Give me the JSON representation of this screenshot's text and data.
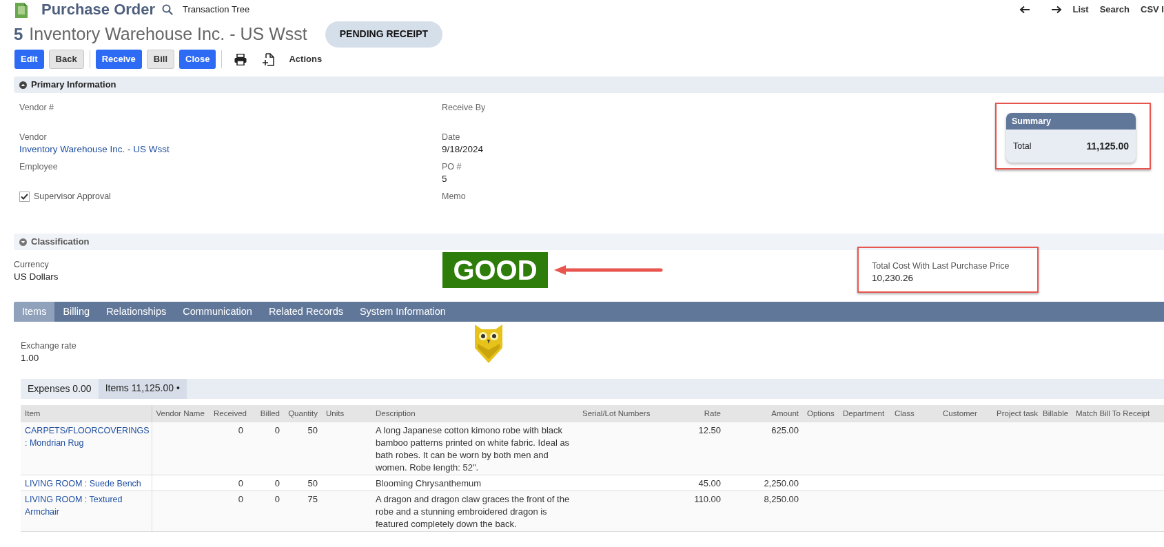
{
  "header": {
    "title": "Purchase Order",
    "link": "Transaction Tree",
    "nav": [
      "List",
      "Search",
      "CSV I"
    ]
  },
  "record": {
    "number": "5",
    "name": "Inventory Warehouse Inc. - US Wsst",
    "status": "PENDING RECEIPT"
  },
  "toolbar": {
    "buttons": [
      {
        "kind": "primary",
        "label": "Edit"
      },
      {
        "kind": "secondary",
        "label": "Back"
      },
      {
        "kind": "separator"
      },
      {
        "kind": "primary",
        "label": "Receive"
      },
      {
        "kind": "secondary",
        "label": "Bill"
      },
      {
        "kind": "primary",
        "label": "Close"
      },
      {
        "kind": "separator"
      },
      {
        "kind": "print"
      },
      {
        "kind": "new-document"
      },
      {
        "kind": "text",
        "label": "Actions"
      }
    ]
  },
  "primary_information": {
    "title": "Primary Information",
    "expanded": true,
    "left_fields": [
      {
        "kind": "field",
        "label": "Vendor #"
      },
      {
        "kind": "link",
        "label": "Vendor",
        "value": "Inventory Warehouse Inc. - US Wsst"
      },
      {
        "kind": "field",
        "label": "Employee"
      },
      {
        "kind": "checkbox",
        "label": "Supervisor Approval",
        "checked": true
      }
    ],
    "middle_fields": [
      {
        "kind": "field",
        "label": "Receive By"
      },
      {
        "kind": "field",
        "label": "Date",
        "value": "9/18/2024"
      },
      {
        "kind": "field",
        "label": "PO #",
        "value": "5"
      },
      {
        "kind": "field",
        "label": "Memo"
      }
    ],
    "summary": {
      "title": "Summary",
      "total_label": "Total",
      "total": "11,125.00"
    }
  },
  "classification": {
    "title": "Classification",
    "expanded": false,
    "currency_label": "Currency",
    "currency": "US Dollars",
    "badge": "GOOD",
    "total_cost_label": "Total Cost With Last Purchase Price",
    "total_cost": "10,230.26"
  },
  "tabs": [
    {
      "label": "Items",
      "selected": true
    },
    {
      "label": "Billing",
      "selected": false
    },
    {
      "label": "Relationships",
      "selected": false
    },
    {
      "label": "Communication",
      "selected": false
    },
    {
      "label": "Related Records",
      "selected": false
    },
    {
      "label": "System Information",
      "selected": false
    }
  ],
  "exchange_rate": {
    "label": "Exchange rate",
    "value": "1.00"
  },
  "subtabs": [
    {
      "label": "Expenses 0.00",
      "selected": false
    },
    {
      "label": "Items 11,125.00 •",
      "selected": true
    }
  ],
  "table": {
    "columns": [
      {
        "label": "Item",
        "kind": "text"
      },
      {
        "label": "Vendor Name",
        "kind": "text"
      },
      {
        "label": "Received",
        "kind": "number"
      },
      {
        "label": "Billed",
        "kind": "number"
      },
      {
        "label": "Quantity",
        "kind": "number"
      },
      {
        "label": "Units",
        "kind": "text"
      },
      {
        "label": "Description",
        "kind": "text"
      },
      {
        "label": "Serial/Lot Numbers",
        "kind": "text"
      },
      {
        "label": "Rate",
        "kind": "number"
      },
      {
        "label": "Amount",
        "kind": "number"
      },
      {
        "label": "Options",
        "kind": "text"
      },
      {
        "label": "Department",
        "kind": "text"
      },
      {
        "label": "Class",
        "kind": "text"
      },
      {
        "label": "Customer",
        "kind": "text"
      },
      {
        "label": "Project task",
        "kind": "text"
      },
      {
        "label": "Billable",
        "kind": "text"
      },
      {
        "label": "Match Bill To Receipt",
        "kind": "text"
      }
    ],
    "rows": [
      {
        "item": "CARPETS/FLOORCOVERINGS : Mondrian Rug",
        "received": "0",
        "billed": "0",
        "quantity": "50",
        "description": "A long Japanese cotton kimono robe with black bamboo patterns printed on white fabric. Ideal as bath robes. It can be worn by both men and women. Robe length: 52\".",
        "rate": "12.50",
        "amount": "625.00"
      },
      {
        "item": "LIVING ROOM : Suede Bench",
        "received": "0",
        "billed": "0",
        "quantity": "50",
        "description": "Blooming Chrysanthemum",
        "rate": "45.00",
        "amount": "2,250.00"
      },
      {
        "item": "LIVING ROOM : Textured Armchair",
        "received": "0",
        "billed": "0",
        "quantity": "75",
        "description": "A dragon and dragon claw graces the front of the robe and a stunning embroidered dragon is featured completely down the back.",
        "rate": "110.00",
        "amount": "8,250.00"
      }
    ]
  }
}
